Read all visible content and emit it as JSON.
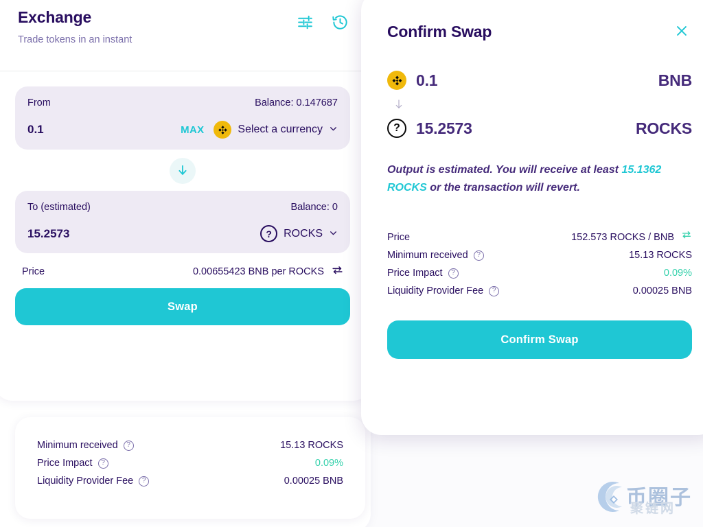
{
  "colors": {
    "accent_teal": "#1FC7D4",
    "text_primary": "#280D5F",
    "text_secondary": "#7A6EAA",
    "panel_bg": "#EEEAF4",
    "success_green": "#31D0AA",
    "bnb_yellow": "#F0B90B"
  },
  "exchange": {
    "title": "Exchange",
    "subtitle": "Trade tokens in an instant",
    "icons": {
      "settings": "settings-sliders-icon",
      "history": "history-clock-icon"
    },
    "from": {
      "label": "From",
      "balance": "Balance: 0.147687",
      "amount": "0.1",
      "max_label": "MAX",
      "currency": "Select a currency",
      "token_icon": "bnb-token-icon"
    },
    "switch_icon": "arrow-down-icon",
    "to": {
      "label": "To (estimated)",
      "balance": "Balance: 0",
      "amount": "15.2573",
      "currency": "ROCKS",
      "token_icon": "unknown-token-icon"
    },
    "price": {
      "label": "Price",
      "value": "0.00655423 BNB per ROCKS",
      "swap_icon": "swap-direction-icon"
    },
    "swap_button": "Swap",
    "details": [
      {
        "label": "Minimum received",
        "value": "15.13 ROCKS",
        "accent": false
      },
      {
        "label": "Price Impact",
        "value": "0.09%",
        "accent": true
      },
      {
        "label": "Liquidity Provider Fee",
        "value": "0.00025 BNB",
        "accent": false
      }
    ]
  },
  "confirm_modal": {
    "title": "Confirm Swap",
    "close_icon": "close-x-icon",
    "from": {
      "amount": "0.1",
      "symbol": "BNB",
      "token_icon": "bnb-token-icon"
    },
    "arrow_icon": "arrow-down-icon",
    "to": {
      "amount": "15.2573",
      "symbol": "ROCKS",
      "token_icon": "unknown-token-icon"
    },
    "estimate_note": {
      "prefix": "Output is estimated. You will receive at least ",
      "highlight": "15.1362 ROCKS",
      "suffix": " or the transaction will revert."
    },
    "details": [
      {
        "label": "Price",
        "value": "152.573 ROCKS / BNB",
        "accent": false,
        "has_swap_icon": true,
        "has_help": false
      },
      {
        "label": "Minimum received",
        "value": "15.13 ROCKS",
        "accent": false,
        "has_swap_icon": false,
        "has_help": true
      },
      {
        "label": "Price Impact",
        "value": "0.09%",
        "accent": true,
        "has_swap_icon": false,
        "has_help": true
      },
      {
        "label": "Liquidity Provider Fee",
        "value": "0.00025 BNB",
        "accent": false,
        "has_swap_icon": false,
        "has_help": true
      }
    ],
    "confirm_button": "Confirm Swap"
  },
  "watermark": {
    "text": "币圈子",
    "subtext": "聚链网"
  }
}
